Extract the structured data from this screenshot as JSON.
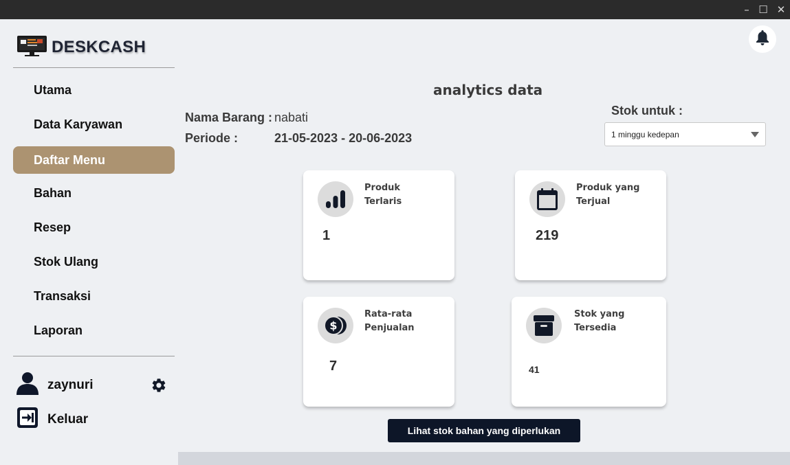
{
  "window": {
    "minimize_glyph": "–",
    "maximize_glyph": "☐",
    "close_glyph": "✕"
  },
  "brand": {
    "name": "DESKCASH"
  },
  "sidebar": {
    "items": [
      {
        "label": "Utama"
      },
      {
        "label": "Data Karyawan"
      },
      {
        "label": "Daftar Menu",
        "active": true
      },
      {
        "label": "Bahan"
      },
      {
        "label": "Resep"
      },
      {
        "label": "Stok Ulang"
      },
      {
        "label": "Transaksi"
      },
      {
        "label": "Laporan"
      }
    ],
    "user": {
      "name": "zaynuri"
    },
    "logout_label": "Keluar"
  },
  "main": {
    "title": "analytics data",
    "nama_barang_label": "Nama Barang :",
    "nama_barang_value": "nabati",
    "periode_label": "Periode :",
    "periode_value": "21-05-2023 - 20-06-2023",
    "stok_untuk_label": "Stok untuk :",
    "stok_untuk_selected": "1 minggu kedepan",
    "cards": [
      {
        "label_line1": "Produk",
        "label_line2": "Terlaris",
        "value": "1",
        "icon": "bar-chart-icon"
      },
      {
        "label_line1": "Produk yang",
        "label_line2": "Terjual",
        "value": "219",
        "icon": "calendar-icon"
      },
      {
        "label_line1": "Rata-rata",
        "label_line2": "Penjualan",
        "value": "7",
        "icon": "coins-icon"
      },
      {
        "label_line1": "Stok yang",
        "label_line2": "Tersedia",
        "value": "41",
        "icon": "box-icon"
      }
    ],
    "action_button": "Lihat stok bahan yang diperlukan"
  },
  "colors": {
    "active_nav": "#ac9371",
    "button_dark": "#0d1628",
    "icon_dark": "#111827",
    "background": "#eef0f3"
  }
}
